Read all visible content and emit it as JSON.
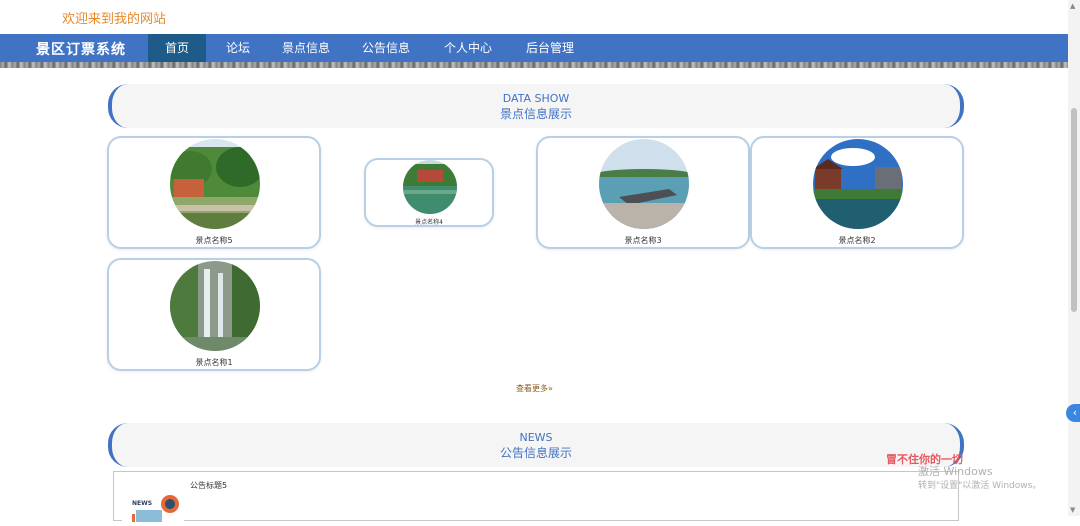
{
  "header": {
    "welcome": "欢迎来到我的网站"
  },
  "nav": {
    "brand": "景区订票系统",
    "items": [
      {
        "label": "首页",
        "active": true
      },
      {
        "label": "论坛",
        "active": false
      },
      {
        "label": "景点信息",
        "active": false
      },
      {
        "label": "公告信息",
        "active": false
      },
      {
        "label": "个人中心",
        "active": false
      },
      {
        "label": "后台管理",
        "active": false
      }
    ]
  },
  "data_show": {
    "title_en": "DATA SHOW",
    "title_cn": "景点信息展示",
    "cards": [
      {
        "label": "景点名称5"
      },
      {
        "label": "景点名称4"
      },
      {
        "label": "景点名称3"
      },
      {
        "label": "景点名称2"
      },
      {
        "label": "景点名称1"
      }
    ],
    "more": "查看更多"
  },
  "news": {
    "title_en": "NEWS",
    "title_cn": "公告信息展示",
    "items": [
      {
        "title": "公告标题5",
        "thumb_text": "NEWS"
      }
    ]
  },
  "overlay": {
    "line1": "冒不住你的一切",
    "line2": "激活 Windows",
    "line3": "转到\"设置\"以激活 Windows。"
  },
  "colors": {
    "nav": "#4173c4",
    "nav_active": "#1f5b89",
    "welcome": "#e58a2c",
    "accent": "#4173c4"
  }
}
